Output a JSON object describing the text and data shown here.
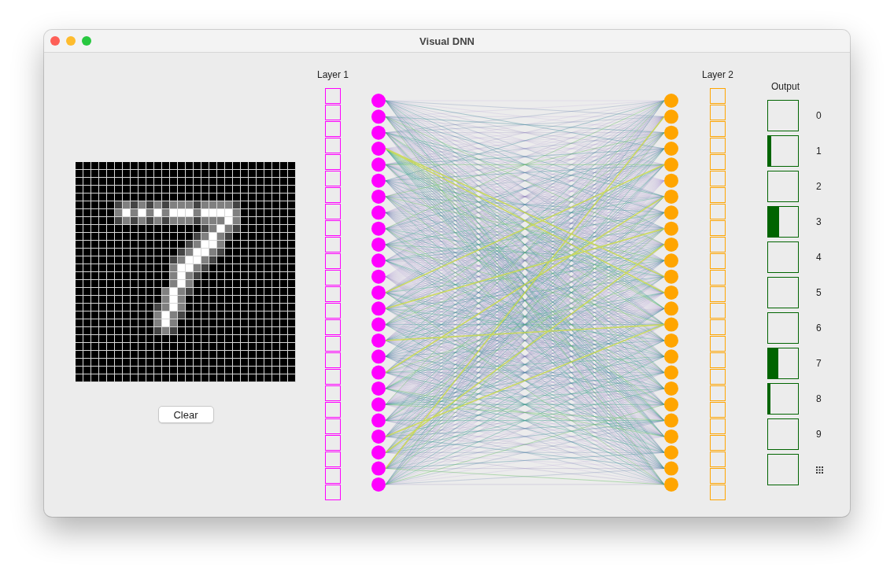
{
  "window": {
    "title": "Visual DNN"
  },
  "clear_button": {
    "label": "Clear"
  },
  "layers": [
    {
      "title": "Layer 1",
      "color": "#ff00ff"
    },
    {
      "title": "Layer 2",
      "color": "#ffa500"
    }
  ],
  "output": {
    "title": "Output",
    "rows": [
      {
        "kind": "digit",
        "label": "0"
      },
      {
        "kind": "digit",
        "label": "1",
        "level": 0.1
      },
      {
        "kind": "digit",
        "label": "2"
      },
      {
        "kind": "digit",
        "label": "3",
        "level": 0.38
      },
      {
        "kind": "digit",
        "label": "4"
      },
      {
        "kind": "digit",
        "label": "5"
      },
      {
        "kind": "digit",
        "label": "6"
      },
      {
        "kind": "digit",
        "label": "7",
        "level": 0.35
      },
      {
        "kind": "digit",
        "label": "8",
        "level": 0.08
      },
      {
        "kind": "digit",
        "label": "9"
      },
      {
        "kind": "icon"
      }
    ]
  }
}
